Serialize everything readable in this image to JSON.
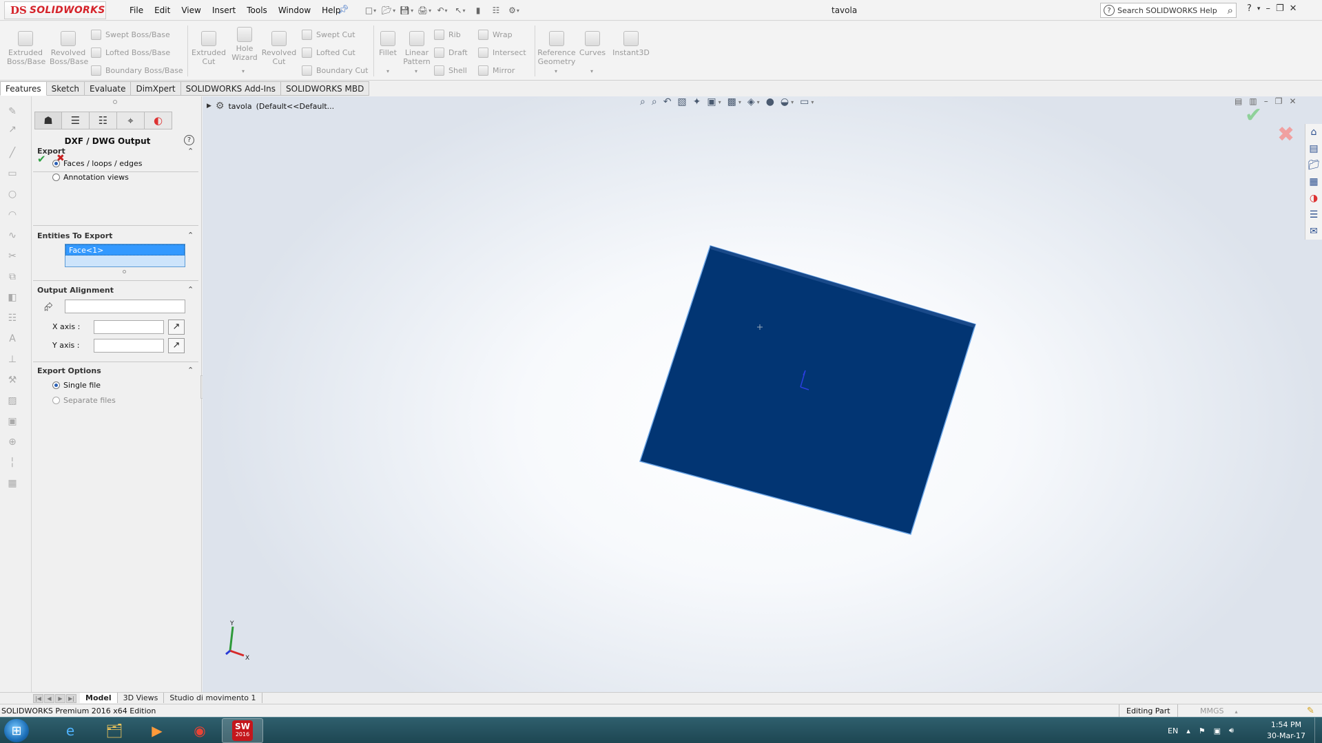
{
  "app": {
    "brand_prefix": "DS",
    "brand_name": "SOLIDWORKS",
    "document_title": "tavola"
  },
  "menu": [
    "File",
    "Edit",
    "View",
    "Insert",
    "Tools",
    "Window",
    "Help"
  ],
  "help_search": {
    "placeholder": "Search SOLIDWORKS Help"
  },
  "ribbon": {
    "extruded_boss": "Extruded Boss/Base",
    "revolved_boss": "Revolved Boss/Base",
    "swept_boss": "Swept Boss/Base",
    "lofted_boss": "Lofted Boss/Base",
    "boundary_boss": "Boundary Boss/Base",
    "extruded_cut": "Extruded Cut",
    "hole_wizard": "Hole Wizard",
    "revolved_cut": "Revolved Cut",
    "swept_cut": "Swept Cut",
    "lofted_cut": "Lofted Cut",
    "boundary_cut": "Boundary Cut",
    "fillet": "Fillet",
    "linear_pattern": "Linear Pattern",
    "rib": "Rib",
    "draft": "Draft",
    "shell": "Shell",
    "wrap": "Wrap",
    "intersect": "Intersect",
    "mirror": "Mirror",
    "reference_geometry": "Reference Geometry",
    "curves": "Curves",
    "instant3d": "Instant3D"
  },
  "cm_tabs": [
    "Features",
    "Sketch",
    "Evaluate",
    "DimXpert",
    "SOLIDWORKS Add-Ins",
    "SOLIDWORKS MBD"
  ],
  "property_manager": {
    "title": "DXF / DWG Output",
    "export_group": {
      "heading": "Export",
      "options": [
        "Faces / loops / edges",
        "Annotation views"
      ],
      "selected": "Faces / loops / edges"
    },
    "entities_group": {
      "heading": "Entities To Export",
      "items": [
        "Face<1>"
      ]
    },
    "alignment_group": {
      "heading": "Output Alignment",
      "x_axis_label": "X axis :",
      "y_axis_label": "Y axis :"
    },
    "options_group": {
      "heading": "Export Options",
      "options": [
        "Single file",
        "Separate files"
      ],
      "selected": "Single file"
    }
  },
  "feature_tree_flyout": {
    "root": "tavola",
    "config": "(Default<<Default..."
  },
  "model_tabs": [
    "Model",
    "3D Views",
    "Studio di movimento 1"
  ],
  "status_bar": {
    "product": "SOLIDWORKS Premium 2016 x64 Edition",
    "mode": "Editing Part",
    "units": "MMGS"
  },
  "taskbar": {
    "active_app_label": "SW",
    "active_app_year": "2016",
    "language": "EN",
    "time": "1:54 PM",
    "date": "30-Mar-17"
  },
  "triad": {
    "y_label": "Y",
    "x_label": "X"
  },
  "colors": {
    "brand_red": "#d5232a",
    "face_fill": "#023573",
    "selection_blue": "#3399ff",
    "ok_green": "#2ea043",
    "cancel_red": "#c82020"
  }
}
